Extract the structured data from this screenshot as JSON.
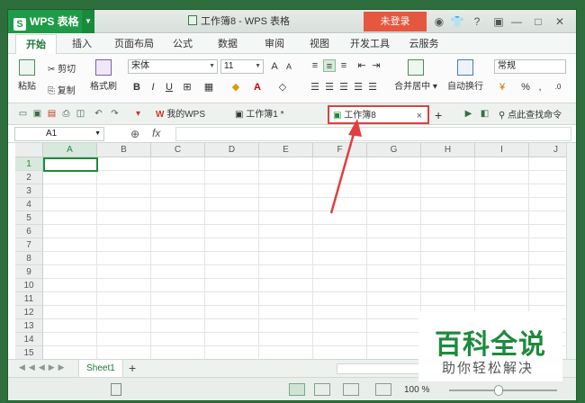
{
  "app": {
    "logo_text": "WPS 表格",
    "logo_letter": "S",
    "title": "工作簿8 - WPS 表格",
    "login_label": "未登录"
  },
  "menu": [
    "开始",
    "插入",
    "页面布局",
    "公式",
    "数据",
    "审阅",
    "视图",
    "开发工具",
    "云服务"
  ],
  "ribbon": {
    "paste": "粘贴",
    "cut": "剪切",
    "copy": "复制",
    "format_painter": "格式刷",
    "font_name": "宋体",
    "font_size": "11",
    "bold": "B",
    "italic": "I",
    "underline": "U",
    "merge_center": "合并居中",
    "wrap_text": "自动换行",
    "number_format": "常规",
    "percent": "%",
    "comma": ","
  },
  "doc_tabs": {
    "home": "我的WPS",
    "tab1": "工作簿1 *",
    "tab8": "工作簿8",
    "close": "×",
    "new": "+",
    "command_search": "点此查找命令"
  },
  "formula": {
    "cell_ref": "A1",
    "fx": "fx"
  },
  "grid": {
    "columns": [
      "A",
      "B",
      "C",
      "D",
      "E",
      "F",
      "G",
      "H",
      "I",
      "J"
    ],
    "rows": [
      "1",
      "2",
      "3",
      "4",
      "5",
      "6",
      "7",
      "8",
      "9",
      "10",
      "11",
      "12",
      "13",
      "14",
      "15"
    ]
  },
  "sheets": {
    "sheet1": "Sheet1",
    "add": "+"
  },
  "status": {
    "zoom": "100 %"
  },
  "watermark": {
    "line1": "百科全说",
    "line2": "助你轻松解决"
  },
  "colors": {
    "accent": "#1e9b46",
    "login": "#e5573f",
    "highlight": "#e23e3e"
  }
}
